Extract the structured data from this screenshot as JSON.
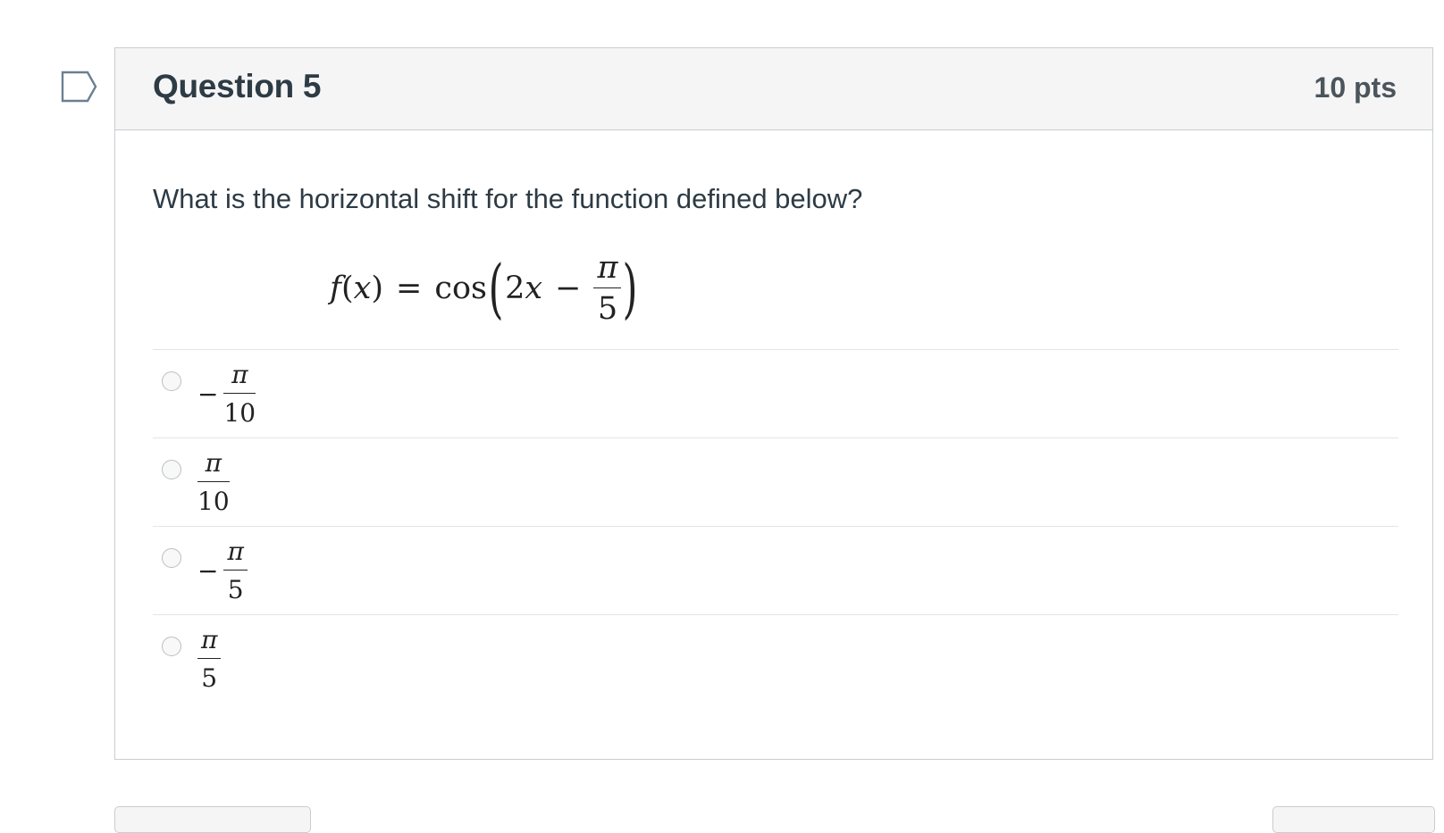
{
  "question": {
    "title": "Question 5",
    "points": "10 pts",
    "prompt": "What is the horizontal shift for the function defined below?",
    "formula": {
      "lhs_f": "f",
      "lhs_open": "(",
      "lhs_x": "x",
      "lhs_close": ")",
      "equals": "=",
      "func": "cos",
      "inner_coef": "2",
      "inner_var": "x",
      "minus": "−",
      "frac_num": "π",
      "frac_den": "5"
    },
    "answers": [
      {
        "sign": "−",
        "num": "π",
        "den": "10"
      },
      {
        "sign": "",
        "num": "π",
        "den": "10"
      },
      {
        "sign": "−",
        "num": "π",
        "den": "5"
      },
      {
        "sign": "",
        "num": "π",
        "den": "5"
      }
    ]
  },
  "colors": {
    "header_bg": "#f5f5f5",
    "border": "#c7cdd1",
    "text": "#2d3b45",
    "flag": "#6b7f91"
  },
  "icons": {
    "flag": "bookmark-flag-icon"
  }
}
